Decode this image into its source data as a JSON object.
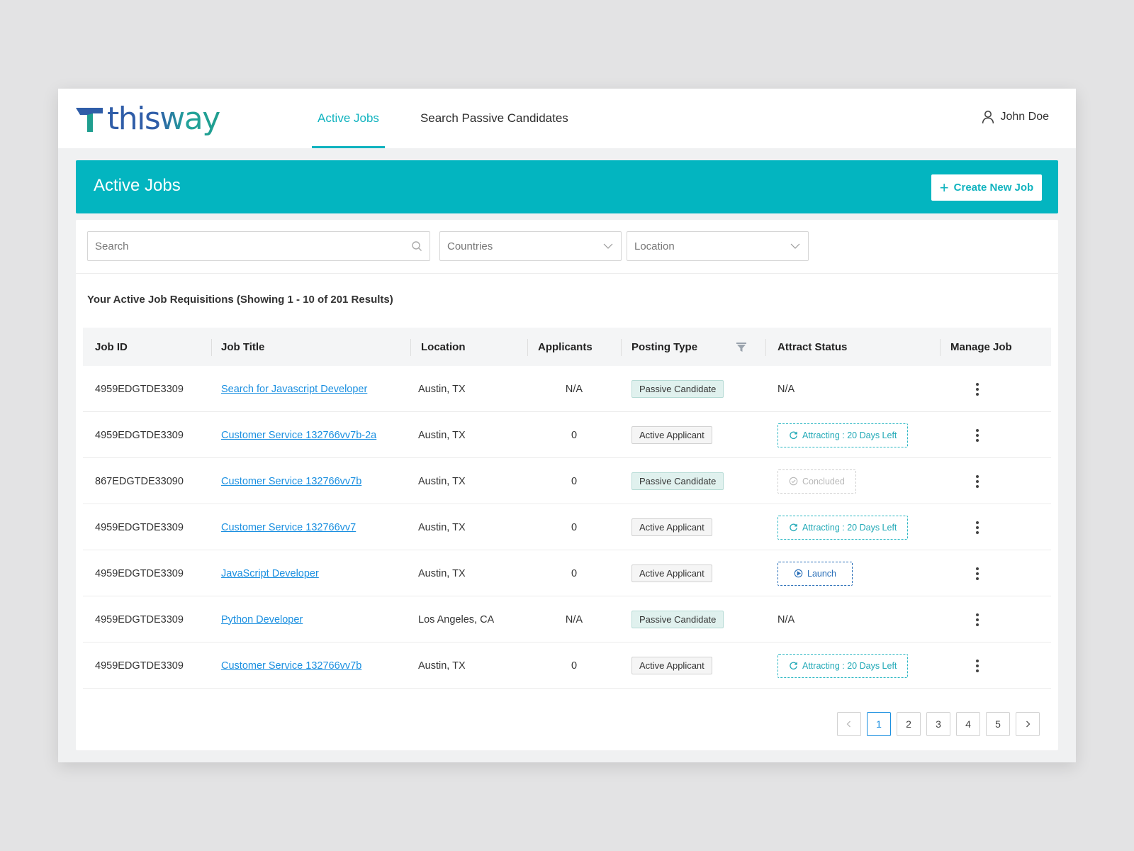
{
  "brand": {
    "name": "thisway"
  },
  "nav": {
    "tabs": [
      {
        "label": "Active Jobs",
        "active": true
      },
      {
        "label": "Search Passive Candidates",
        "active": false
      }
    ],
    "user": {
      "name": "John Doe",
      "icon": "user-icon"
    }
  },
  "banner": {
    "title": "Active Jobs",
    "create_button": {
      "icon": "plus-icon",
      "label": "Create New Job"
    }
  },
  "filters": {
    "search": {
      "placeholder": "Search",
      "value": "",
      "icon": "search-icon"
    },
    "countries": {
      "placeholder": "Countries",
      "icon": "chevron-down-icon"
    },
    "location": {
      "placeholder": "Location",
      "icon": "chevron-down-icon"
    }
  },
  "results_title": "Your Active Job Requisitions (Showing 1 - 10 of 201 Results)",
  "table": {
    "columns": [
      "Job ID",
      "Job Title",
      "Location",
      "Applicants",
      "Posting Type",
      "Attract Status",
      "Manage Job"
    ],
    "rows": [
      {
        "job_id": "4959EDGTDE3309",
        "title": "Search for Javascript Developer",
        "location": "Austin, TX",
        "applicants": "N/A",
        "posting_type": "Passive Candidate",
        "status_type": "na",
        "status": "N/A"
      },
      {
        "job_id": "4959EDGTDE3309",
        "title": "Customer Service 132766vv7b-2a",
        "location": "Austin, TX",
        "applicants": "0",
        "posting_type": "Active Applicant",
        "status_type": "attracting",
        "status": "Attracting : 20 Days Left"
      },
      {
        "job_id": "867EDGTDE33090",
        "title": "Customer Service 132766vv7b",
        "location": "Austin, TX",
        "applicants": "0",
        "posting_type": "Passive Candidate",
        "status_type": "concluded",
        "status": "Concluded"
      },
      {
        "job_id": "4959EDGTDE3309",
        "title": "Customer Service 132766vv7",
        "location": "Austin, TX",
        "applicants": "0",
        "posting_type": "Active Applicant",
        "status_type": "attracting",
        "status": "Attracting : 20 Days Left"
      },
      {
        "job_id": "4959EDGTDE3309",
        "title": "JavaScript Developer",
        "location": "Austin, TX",
        "applicants": "0",
        "posting_type": "Active Applicant",
        "status_type": "launch",
        "status": "Launch"
      },
      {
        "job_id": "4959EDGTDE3309",
        "title": "Python Developer",
        "location": "Los Angeles, CA",
        "applicants": "N/A",
        "posting_type": "Passive Candidate",
        "status_type": "na",
        "status": "N/A"
      },
      {
        "job_id": "4959EDGTDE3309",
        "title": "Customer Service 132766vv7b",
        "location": "Austin, TX",
        "applicants": "0",
        "posting_type": "Active Applicant",
        "status_type": "attracting",
        "status": "Attracting : 20 Days Left"
      }
    ]
  },
  "pagination": {
    "pages": [
      "1",
      "2",
      "3",
      "4",
      "5"
    ],
    "current": "1"
  },
  "colors": {
    "accent": "#03b5c0",
    "link": "#1a8fe0",
    "passive_pill": "#e0f1ee",
    "launch": "#2a6fb8"
  }
}
